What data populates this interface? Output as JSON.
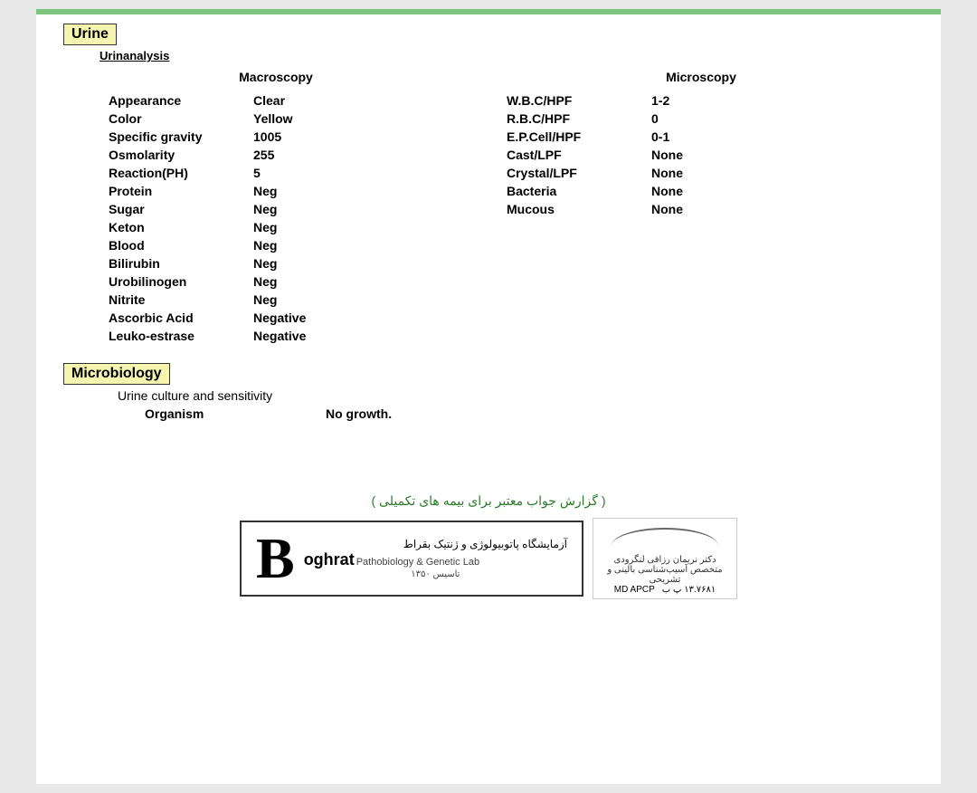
{
  "top_bar_color": "#7dc67e",
  "header_text": "آزمایشگاه پاتوبیولوژی و ژنتیک بقراط",
  "urine_section": {
    "title": "Urine",
    "subsection": "Urinanalysis",
    "macroscopy_header": "Macroscopy",
    "microscopy_header": "Microscopy",
    "macroscopy_rows": [
      {
        "label": "Appearance",
        "value": "Clear"
      },
      {
        "label": "Color",
        "value": "Yellow"
      },
      {
        "label": "Specific gravity",
        "value": "1005"
      },
      {
        "label": "Osmolarity",
        "value": "255"
      },
      {
        "label": "Reaction(PH)",
        "value": "5"
      },
      {
        "label": "Protein",
        "value": "Neg"
      },
      {
        "label": "Sugar",
        "value": "Neg"
      },
      {
        "label": "Keton",
        "value": "Neg"
      },
      {
        "label": "Blood",
        "value": "Neg"
      },
      {
        "label": "Bilirubin",
        "value": "Neg"
      },
      {
        "label": "Urobilinogen",
        "value": "Neg"
      },
      {
        "label": "Nitrite",
        "value": "Neg"
      },
      {
        "label": "Ascorbic Acid",
        "value": "Negative"
      },
      {
        "label": "Leuko-estrase",
        "value": "Negative"
      }
    ],
    "microscopy_rows": [
      {
        "label": "W.B.C/HPF",
        "value": "1-2"
      },
      {
        "label": "R.B.C/HPF",
        "value": "0"
      },
      {
        "label": "E.P.Cell/HPF",
        "value": "0-1"
      },
      {
        "label": "Cast/LPF",
        "value": "None"
      },
      {
        "label": "Crystal/LPF",
        "value": "None"
      },
      {
        "label": "Bacteria",
        "value": "None"
      },
      {
        "label": "Mucous",
        "value": "None"
      }
    ]
  },
  "microbiology_section": {
    "title": "Microbiology",
    "subsection": "Urine culture and sensitivity",
    "organism_label": "Organism",
    "organism_value": "No growth."
  },
  "footer": {
    "arabic_text": "( گزارش جواب معتبر برای بیمه های تکمیلی )",
    "lab_name_arabic": "آزمایشگاه پاتوبیولوژی و ژنتیک بقراط",
    "lab_name_en": "oghrat",
    "lab_sub": "Pathobiology & Genetic Lab",
    "lab_founded": "تاسیس ۱۳۵۰",
    "doctor_name_arabic": "دکتر نریمان رزاقی لنگرودی",
    "doctor_specialty": "متخصص آسیب‌شناسی بالینی و تشریحی",
    "doctor_id": "۱۳.۷۶۸۱ پ ب",
    "doctor_degree": "MD APCP"
  }
}
